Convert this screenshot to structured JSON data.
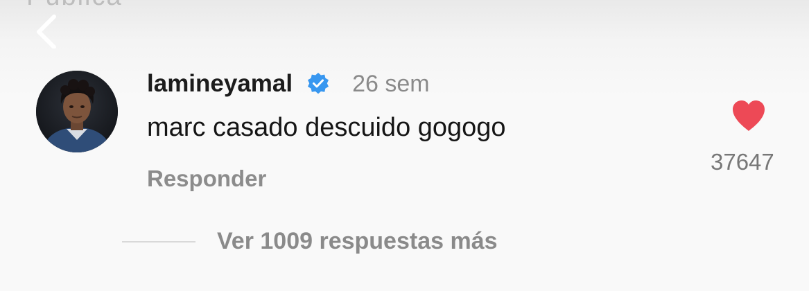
{
  "header": {
    "partial_text": "Publica",
    "back_icon": "chevron-left-icon"
  },
  "comment": {
    "username": "lamineyamal",
    "verified_icon": "verified-badge-icon",
    "verified_color": "#3897f0",
    "timestamp": "26 sem",
    "text": "marc casado descuido gogogo",
    "reply_label": "Responder",
    "like_icon": "heart-icon",
    "like_color": "#ed4956",
    "like_count": "37647"
  },
  "replies": {
    "view_more_label": "Ver 1009 respuestas más"
  }
}
